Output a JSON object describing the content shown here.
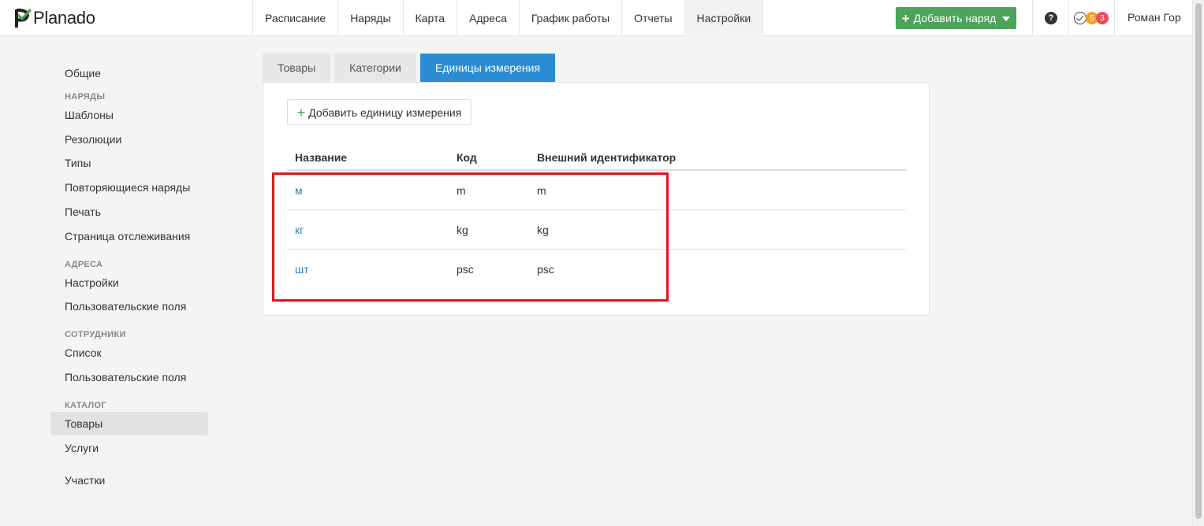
{
  "app": {
    "logo_text": "Planado",
    "nav": [
      "Расписание",
      "Наряды",
      "Карта",
      "Адреса",
      "График работы",
      "Отчеты",
      "Настройки"
    ],
    "active_nav": "Настройки",
    "add_order_label": "Добавить наряд",
    "help_label": "?",
    "notifications": {
      "orange_count": "5",
      "red_count": "3"
    },
    "user_name": "Роман Гор",
    "colors": {
      "accent_green": "#4ca35a",
      "accent_blue": "#2a8dd4",
      "link_blue": "#2a7fbf",
      "highlight_red": "#e2141b"
    }
  },
  "sidebar": {
    "general": "Общие",
    "orders_section": "Наряды",
    "orders_items": [
      "Шаблоны",
      "Резолюции",
      "Типы",
      "Повторяющиеся наряды",
      "Печать",
      "Страница отслеживания"
    ],
    "addresses_section": "Адреса",
    "addresses_items": [
      "Настройки",
      "Пользовательские поля"
    ],
    "employees_section": "Сотрудники",
    "employees_items": [
      "Список",
      "Пользовательские поля"
    ],
    "catalog_section": "Каталог",
    "catalog_items": [
      "Товары",
      "Услуги"
    ],
    "active_item": "Товары",
    "areas": "Участки"
  },
  "main": {
    "tabs": [
      "Товары",
      "Категории",
      "Единицы измерения"
    ],
    "active_tab": "Единицы измерения",
    "add_unit_label": "Добавить единицу измерения",
    "table": {
      "headers": [
        "Название",
        "Код",
        "Внешний идентификатор"
      ],
      "rows": [
        {
          "name": "м",
          "code": "m",
          "external_id": "m"
        },
        {
          "name": "кг",
          "code": "kg",
          "external_id": "kg"
        },
        {
          "name": "шт",
          "code": "psc",
          "external_id": "psc"
        }
      ]
    }
  }
}
